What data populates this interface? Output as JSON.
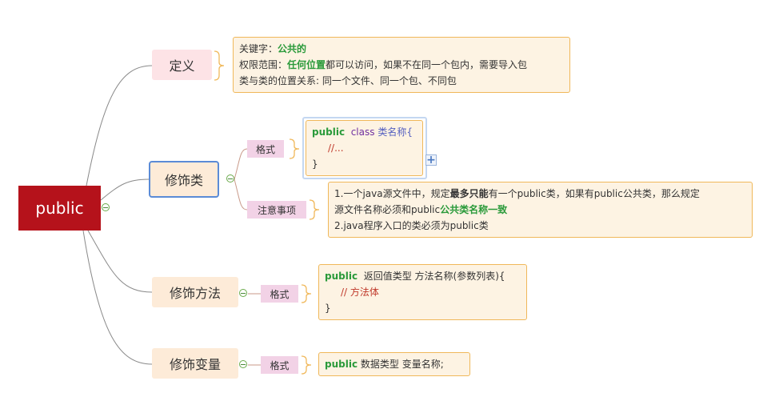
{
  "root": {
    "label": "public"
  },
  "topics": [
    {
      "id": "definition",
      "label": "定义"
    },
    {
      "id": "modify-class",
      "label": "修饰类"
    },
    {
      "id": "modify-method",
      "label": "修饰方法"
    },
    {
      "id": "modify-variable",
      "label": "修饰变量"
    }
  ],
  "subtopics": {
    "format": "格式",
    "notice": "注意事项"
  },
  "notes": {
    "definition": {
      "line1_prefix": "关键字：",
      "line1_kw": "公共的",
      "line2_prefix": "权限范围：",
      "line2_strong": "任何位置",
      "line2_rest": "都可以访问，如果不在同一个包内，需要导入包",
      "line3": "类与类的位置关系: 同一个文件、同一个包、不同包"
    },
    "class_format": {
      "kw": "public",
      "kw2": "class",
      "name": "类名称{",
      "comment": "//...",
      "close": "}"
    },
    "class_notice": {
      "l1_a": "1.一个java源文件中，规定",
      "l1_b": "最多只能",
      "l1_c": "有一个public类，如果有public公共类，那么规定",
      "l2_a": "源文件名称必须和public",
      "l2_b": "公共类名称一致",
      "l3": "2.java程序入口的类必须为public类"
    },
    "method_format": {
      "kw": "public",
      "sig": "返回值类型 方法名称(参数列表){",
      "comment": "// 方法体",
      "close": "}"
    },
    "variable_format": {
      "kw": "public",
      "rest": "数据类型 变量名称;"
    }
  },
  "colors": {
    "root": "#b5121b",
    "keyword": "#2a9a3a",
    "note_border": "#f0b85a"
  }
}
